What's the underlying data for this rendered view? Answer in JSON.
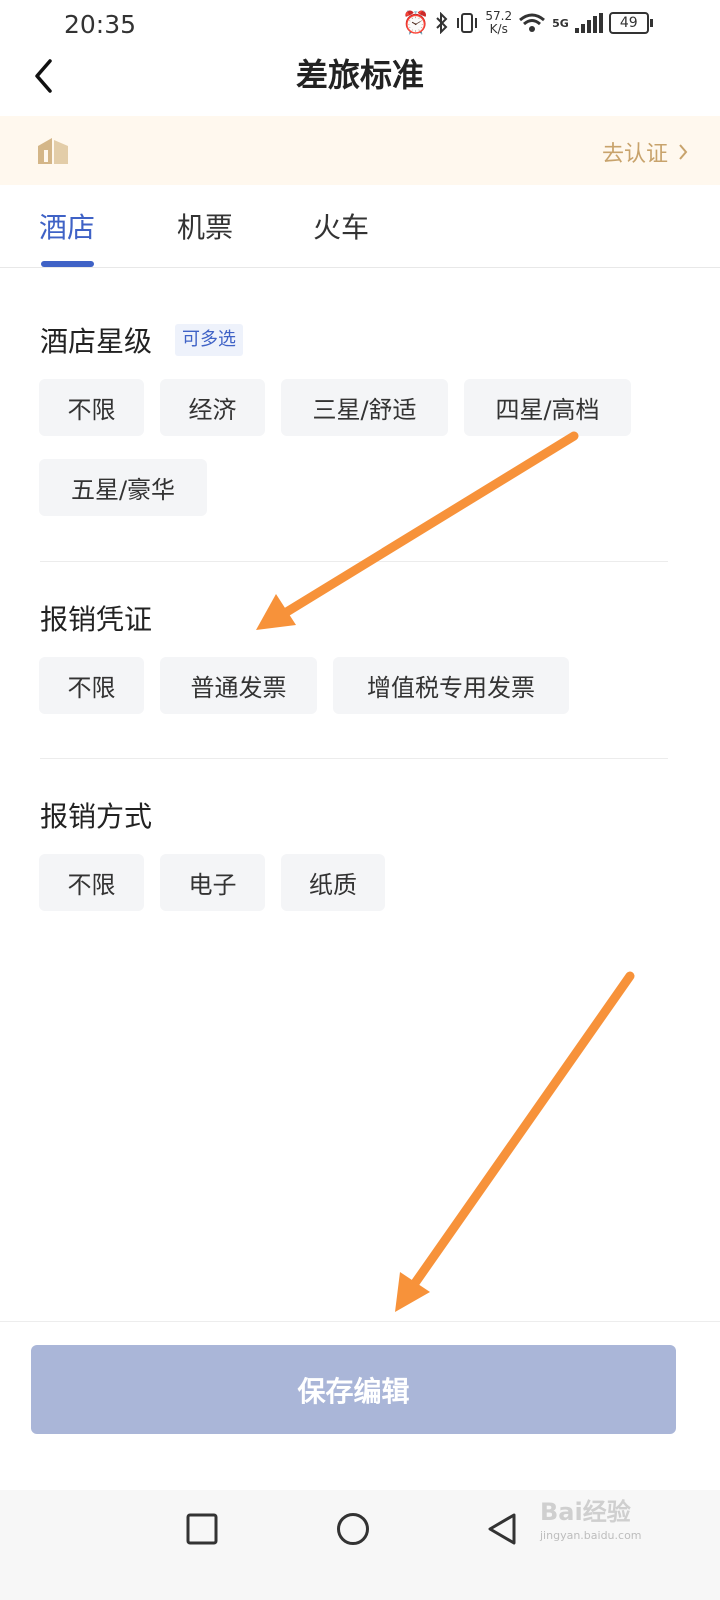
{
  "status_bar": {
    "time": "20:35",
    "speed_value": "57.2",
    "speed_unit": "K/s",
    "network": "5G",
    "battery": "49"
  },
  "header": {
    "title": "差旅标准",
    "back_icon": "chevron-left-icon"
  },
  "banner": {
    "link_label": "去认证",
    "logo_icon": "building-icon"
  },
  "tabs": [
    {
      "label": "酒店",
      "active": true
    },
    {
      "label": "机票",
      "active": false
    },
    {
      "label": "火车",
      "active": false
    }
  ],
  "sections": {
    "hotel_star": {
      "title": "酒店星级",
      "badge": "可多选",
      "options": [
        "不限",
        "经济",
        "三星/舒适",
        "四星/高档",
        "五星/豪华"
      ]
    },
    "voucher": {
      "title": "报销凭证",
      "options": [
        "不限",
        "普通发票",
        "增值税专用发票"
      ]
    },
    "method": {
      "title": "报销方式",
      "options": [
        "不限",
        "电子",
        "纸质"
      ]
    }
  },
  "save_button": "保存编辑",
  "watermark": {
    "brand": "Bai经验",
    "url": "jingyan.baidu.com"
  },
  "colors": {
    "accent": "#3f62c6",
    "save_button": "#aab6d8",
    "banner_bg": "#fff8ee",
    "annotation_arrow": "#f7923a"
  }
}
